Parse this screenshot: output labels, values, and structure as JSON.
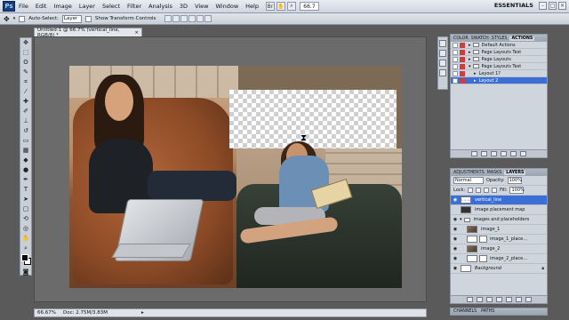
{
  "menubar": {
    "app_logo": "Ps",
    "items": [
      "File",
      "Edit",
      "Image",
      "Layer",
      "Select",
      "Filter",
      "Analysis",
      "3D",
      "View",
      "Window",
      "Help"
    ],
    "zoom": "66.7",
    "workspace": "ESSENTIALS"
  },
  "options": {
    "auto_select_label": "Auto-Select:",
    "auto_select_value": "Layer",
    "transform_controls_label": "Show Transform Controls"
  },
  "document": {
    "tab_title": "Untitled-1 @ 66.7% (vertical_line, RGB/8) *",
    "close_glyph": "×"
  },
  "status": {
    "zoom": "66.67%",
    "doc_size": "Doc: 2.75M/3.83M"
  },
  "actions_panel": {
    "tabs": [
      "COLOR",
      "SWATCH",
      "STYLES",
      "ACTIONS"
    ],
    "active_tab": "ACTIONS",
    "items": [
      {
        "label": "Default Actions",
        "type": "folder"
      },
      {
        "label": "Page Layouts Test",
        "type": "folder"
      },
      {
        "label": "Page Layouts",
        "type": "folder"
      },
      {
        "label": "Page Layouts Test",
        "type": "folder"
      },
      {
        "label": "Layout 1?",
        "type": "action"
      },
      {
        "label": "Layout 2",
        "type": "action",
        "selected": true
      }
    ]
  },
  "layers_panel": {
    "tabs": [
      "ADJUSTMENTS",
      "MASKS",
      "LAYERS"
    ],
    "active_tab": "LAYERS",
    "blend_mode": "Normal",
    "opacity_label": "Opacity:",
    "opacity_value": "100%",
    "lock_label": "Lock:",
    "fill_label": "Fill:",
    "fill_value": "100%",
    "layers": [
      {
        "label": "vertical_line",
        "thumb": "checker",
        "selected": true
      },
      {
        "label": "image placement map",
        "thumb": "dark"
      },
      {
        "label": "images and placeholders",
        "thumb": "folder"
      },
      {
        "label": "image_1",
        "thumb": "photo",
        "indent": 1
      },
      {
        "label": "image_1_place...",
        "thumb": "white",
        "indent": 2
      },
      {
        "label": "image_2",
        "thumb": "photo",
        "indent": 1
      },
      {
        "label": "image_2_place...",
        "thumb": "white",
        "indent": 2
      },
      {
        "label": "Background",
        "thumb": "white",
        "italic": true
      }
    ]
  },
  "bottom_tabs": [
    "CHANNELS",
    "PATHS"
  ],
  "colors": {
    "selection_blue": "#3b6fd6",
    "panel_gray": "#cfd5dd",
    "canvas_gray": "#6b6b6b"
  }
}
